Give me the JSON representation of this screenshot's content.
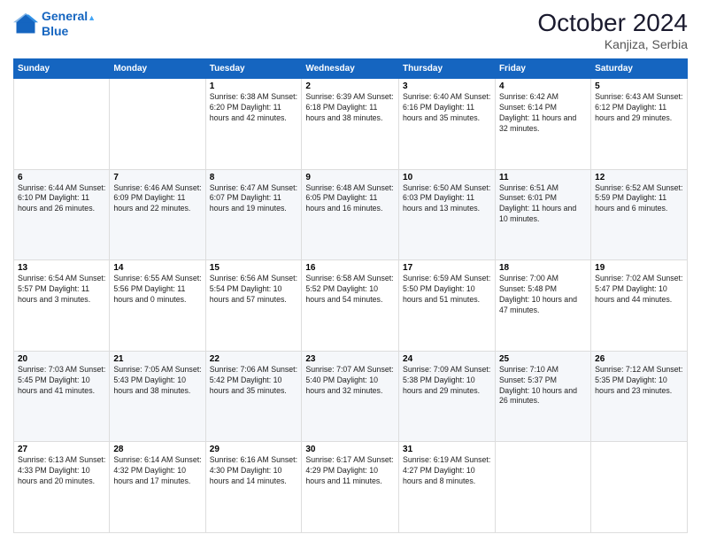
{
  "header": {
    "logo_line1": "General",
    "logo_line2": "Blue",
    "month": "October 2024",
    "location": "Kanjiza, Serbia"
  },
  "weekdays": [
    "Sunday",
    "Monday",
    "Tuesday",
    "Wednesday",
    "Thursday",
    "Friday",
    "Saturday"
  ],
  "weeks": [
    [
      {
        "day": "",
        "info": ""
      },
      {
        "day": "",
        "info": ""
      },
      {
        "day": "1",
        "info": "Sunrise: 6:38 AM\nSunset: 6:20 PM\nDaylight: 11 hours and 42 minutes."
      },
      {
        "day": "2",
        "info": "Sunrise: 6:39 AM\nSunset: 6:18 PM\nDaylight: 11 hours and 38 minutes."
      },
      {
        "day": "3",
        "info": "Sunrise: 6:40 AM\nSunset: 6:16 PM\nDaylight: 11 hours and 35 minutes."
      },
      {
        "day": "4",
        "info": "Sunrise: 6:42 AM\nSunset: 6:14 PM\nDaylight: 11 hours and 32 minutes."
      },
      {
        "day": "5",
        "info": "Sunrise: 6:43 AM\nSunset: 6:12 PM\nDaylight: 11 hours and 29 minutes."
      }
    ],
    [
      {
        "day": "6",
        "info": "Sunrise: 6:44 AM\nSunset: 6:10 PM\nDaylight: 11 hours and 26 minutes."
      },
      {
        "day": "7",
        "info": "Sunrise: 6:46 AM\nSunset: 6:09 PM\nDaylight: 11 hours and 22 minutes."
      },
      {
        "day": "8",
        "info": "Sunrise: 6:47 AM\nSunset: 6:07 PM\nDaylight: 11 hours and 19 minutes."
      },
      {
        "day": "9",
        "info": "Sunrise: 6:48 AM\nSunset: 6:05 PM\nDaylight: 11 hours and 16 minutes."
      },
      {
        "day": "10",
        "info": "Sunrise: 6:50 AM\nSunset: 6:03 PM\nDaylight: 11 hours and 13 minutes."
      },
      {
        "day": "11",
        "info": "Sunrise: 6:51 AM\nSunset: 6:01 PM\nDaylight: 11 hours and 10 minutes."
      },
      {
        "day": "12",
        "info": "Sunrise: 6:52 AM\nSunset: 5:59 PM\nDaylight: 11 hours and 6 minutes."
      }
    ],
    [
      {
        "day": "13",
        "info": "Sunrise: 6:54 AM\nSunset: 5:57 PM\nDaylight: 11 hours and 3 minutes."
      },
      {
        "day": "14",
        "info": "Sunrise: 6:55 AM\nSunset: 5:56 PM\nDaylight: 11 hours and 0 minutes."
      },
      {
        "day": "15",
        "info": "Sunrise: 6:56 AM\nSunset: 5:54 PM\nDaylight: 10 hours and 57 minutes."
      },
      {
        "day": "16",
        "info": "Sunrise: 6:58 AM\nSunset: 5:52 PM\nDaylight: 10 hours and 54 minutes."
      },
      {
        "day": "17",
        "info": "Sunrise: 6:59 AM\nSunset: 5:50 PM\nDaylight: 10 hours and 51 minutes."
      },
      {
        "day": "18",
        "info": "Sunrise: 7:00 AM\nSunset: 5:48 PM\nDaylight: 10 hours and 47 minutes."
      },
      {
        "day": "19",
        "info": "Sunrise: 7:02 AM\nSunset: 5:47 PM\nDaylight: 10 hours and 44 minutes."
      }
    ],
    [
      {
        "day": "20",
        "info": "Sunrise: 7:03 AM\nSunset: 5:45 PM\nDaylight: 10 hours and 41 minutes."
      },
      {
        "day": "21",
        "info": "Sunrise: 7:05 AM\nSunset: 5:43 PM\nDaylight: 10 hours and 38 minutes."
      },
      {
        "day": "22",
        "info": "Sunrise: 7:06 AM\nSunset: 5:42 PM\nDaylight: 10 hours and 35 minutes."
      },
      {
        "day": "23",
        "info": "Sunrise: 7:07 AM\nSunset: 5:40 PM\nDaylight: 10 hours and 32 minutes."
      },
      {
        "day": "24",
        "info": "Sunrise: 7:09 AM\nSunset: 5:38 PM\nDaylight: 10 hours and 29 minutes."
      },
      {
        "day": "25",
        "info": "Sunrise: 7:10 AM\nSunset: 5:37 PM\nDaylight: 10 hours and 26 minutes."
      },
      {
        "day": "26",
        "info": "Sunrise: 7:12 AM\nSunset: 5:35 PM\nDaylight: 10 hours and 23 minutes."
      }
    ],
    [
      {
        "day": "27",
        "info": "Sunrise: 6:13 AM\nSunset: 4:33 PM\nDaylight: 10 hours and 20 minutes."
      },
      {
        "day": "28",
        "info": "Sunrise: 6:14 AM\nSunset: 4:32 PM\nDaylight: 10 hours and 17 minutes."
      },
      {
        "day": "29",
        "info": "Sunrise: 6:16 AM\nSunset: 4:30 PM\nDaylight: 10 hours and 14 minutes."
      },
      {
        "day": "30",
        "info": "Sunrise: 6:17 AM\nSunset: 4:29 PM\nDaylight: 10 hours and 11 minutes."
      },
      {
        "day": "31",
        "info": "Sunrise: 6:19 AM\nSunset: 4:27 PM\nDaylight: 10 hours and 8 minutes."
      },
      {
        "day": "",
        "info": ""
      },
      {
        "day": "",
        "info": ""
      }
    ]
  ]
}
